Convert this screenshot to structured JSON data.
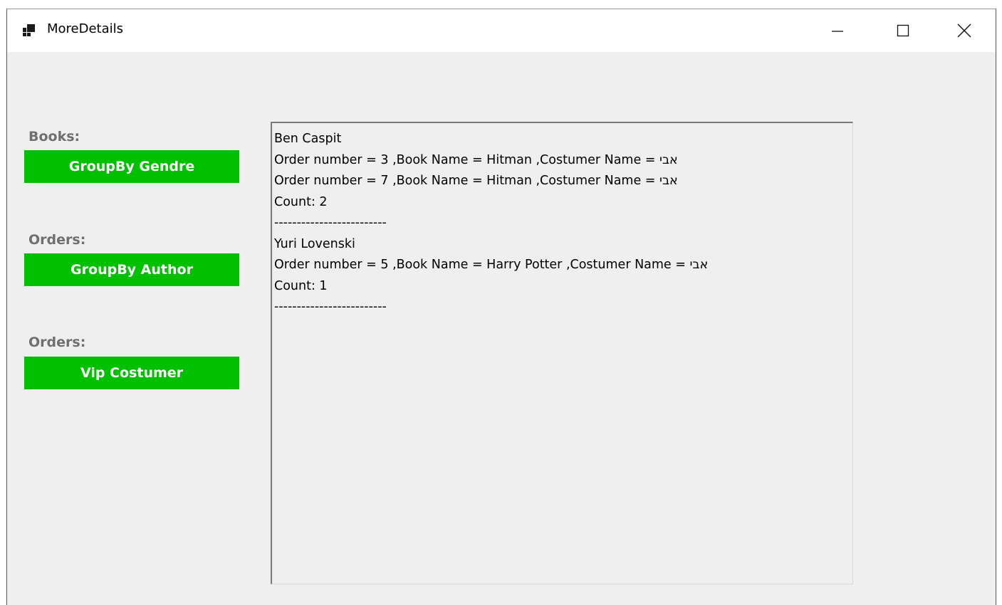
{
  "window": {
    "title": "MoreDetails",
    "icon": "app-window-icon"
  },
  "controls": {
    "minimize_icon": "minimize-icon",
    "maximize_icon": "maximize-icon",
    "close_icon": "close-icon"
  },
  "left_panel": {
    "groups": [
      {
        "label": "Books:",
        "button_label": "GroupBy Gendre"
      },
      {
        "label": "Orders:",
        "button_label": "GroupBy Author"
      },
      {
        "label": "Orders:",
        "button_label": "Vip Costumer"
      }
    ],
    "button_color": "#00c000",
    "label_color": "#6f6f6f"
  },
  "results_list": {
    "lines": [
      "Ben Caspit",
      "Order number = 3 ,Book Name = Hitman ,Costumer Name = אבי",
      "Order number = 7 ,Book Name = Hitman ,Costumer Name = אבי",
      "Count: 2",
      "-------------------------",
      "Yuri Lovenski",
      "Order number = 5 ,Book Name = Harry Potter ,Costumer Name = אבי",
      "Count: 1",
      "-------------------------"
    ]
  }
}
